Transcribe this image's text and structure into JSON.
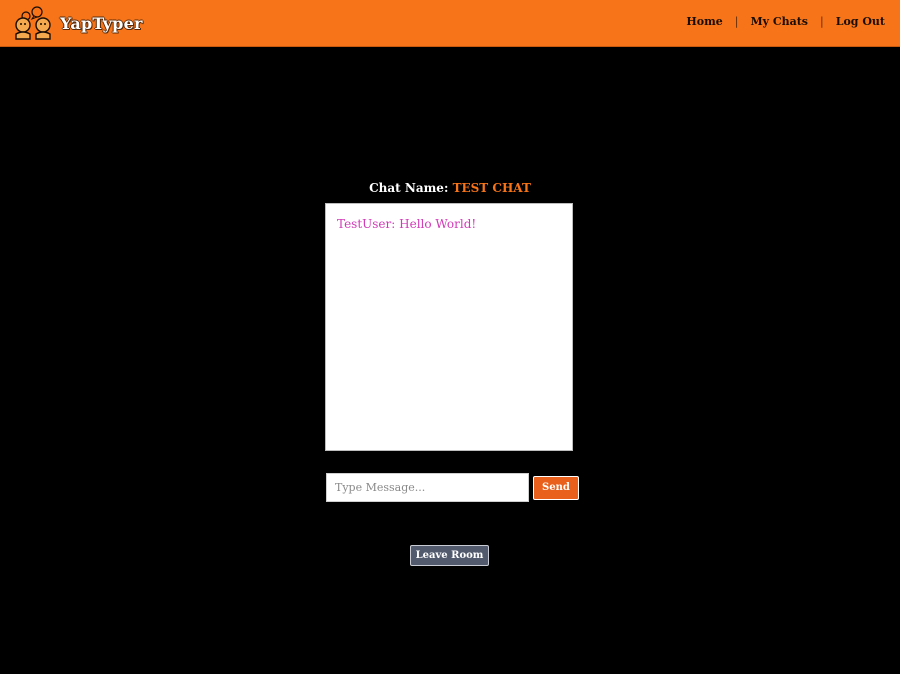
{
  "navbar": {
    "brand": {
      "name": "YapTyper",
      "logo_icon": "chat-people-icon"
    },
    "links": [
      {
        "label": "Home"
      },
      {
        "label": "My Chats"
      },
      {
        "label": "Log Out"
      }
    ],
    "separator": "|",
    "background_color": "#f77419"
  },
  "chat": {
    "title_label": "Chat Name:",
    "room_name": "TEST CHAT",
    "messages": [
      {
        "text": "TestUser: Hello World!"
      }
    ],
    "message_color": "#d23ab8"
  },
  "composer": {
    "placeholder": "Type Message...",
    "value": "",
    "send_label": "Send"
  },
  "leave_label": "Leave Room",
  "colors": {
    "accent": "#f77419",
    "page_background": "#000000",
    "leave_button": "#525a6e"
  }
}
